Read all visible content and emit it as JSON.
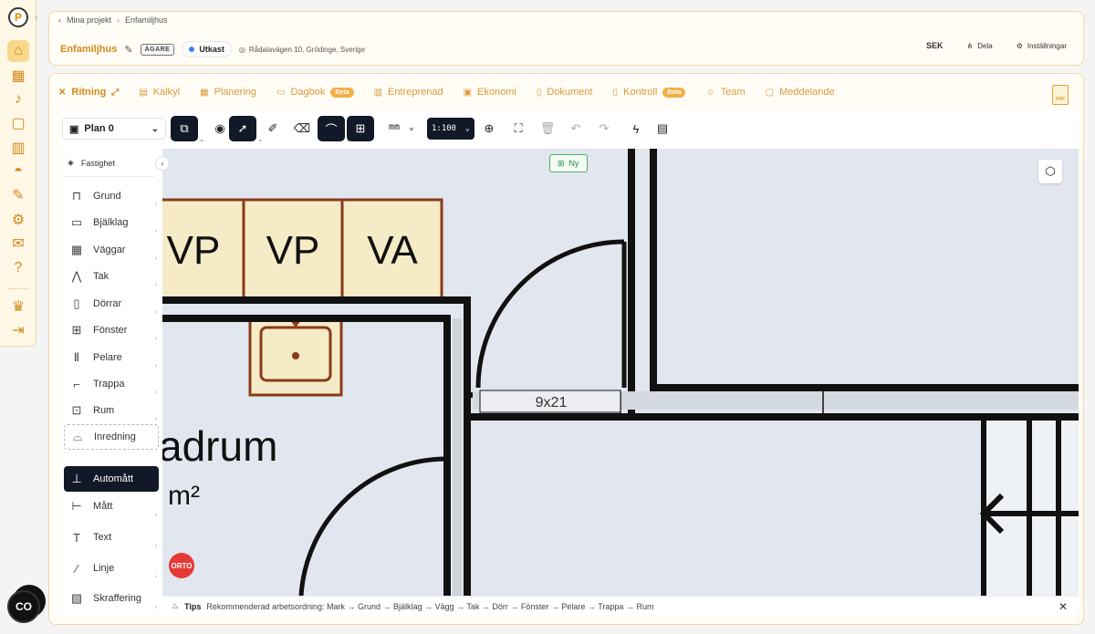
{
  "breadcrumb": {
    "parent": "Mina projekt",
    "current": "Enfamiljhus"
  },
  "project": {
    "title": "Enfamiljhus",
    "owner_badge": "ÄGARE",
    "status": "Utkast",
    "address": "Rådalavägen 10, Grödinge, Sverige"
  },
  "header_actions": {
    "currency": "SEK",
    "share": "Dela",
    "settings": "Inställningar"
  },
  "tabs": [
    {
      "label": "Ritning",
      "icon": "ruler-icon"
    },
    {
      "label": "Kalkyl",
      "icon": "calculator-icon"
    },
    {
      "label": "Planering",
      "icon": "calendar-icon"
    },
    {
      "label": "Dagbok",
      "icon": "book-icon",
      "badge": "Beta"
    },
    {
      "label": "Entreprenad",
      "icon": "building-icon"
    },
    {
      "label": "Ekonomi",
      "icon": "wallet-icon"
    },
    {
      "label": "Dokument",
      "icon": "document-icon"
    },
    {
      "label": "Kontroll",
      "icon": "clipboard-icon",
      "badge": "Beta"
    },
    {
      "label": "Team",
      "icon": "users-icon"
    },
    {
      "label": "Meddelande",
      "icon": "message-icon"
    }
  ],
  "pdf_label": "PDF",
  "toolbar": {
    "plan": "Plan 0",
    "unit": "mm",
    "scale": "1:100"
  },
  "canvas": {
    "new_button": "Ny",
    "labels": {
      "vp1": "VP",
      "vp2": "VP",
      "va": "VA",
      "door": "9x21",
      "room": "adrum",
      "area": "m²"
    },
    "orto": "ORTO"
  },
  "side_panel": {
    "fastighet": "Fastighet",
    "tools": [
      "Grund",
      "Bjälklag",
      "Väggar",
      "Tak",
      "Dörrar",
      "Fönster",
      "Pelare",
      "Trappa",
      "Rum",
      "Inredning",
      "Automått",
      "Mått",
      "Text",
      "Linje",
      "Skraffering"
    ]
  },
  "tips": {
    "label": "Tips",
    "text": "Rekommenderad arbetsordning: Mark → Grund → Bjälklag → Vägg → Tak → Dörr → Fönster → Pelare → Trappa → Rum"
  },
  "colors": {
    "accent": "#d2891a",
    "dark": "#111827",
    "canvas": "#e2e6ee",
    "cabinet_fill": "#f5ecc7",
    "cabinet_border": "#8b3a1a"
  }
}
